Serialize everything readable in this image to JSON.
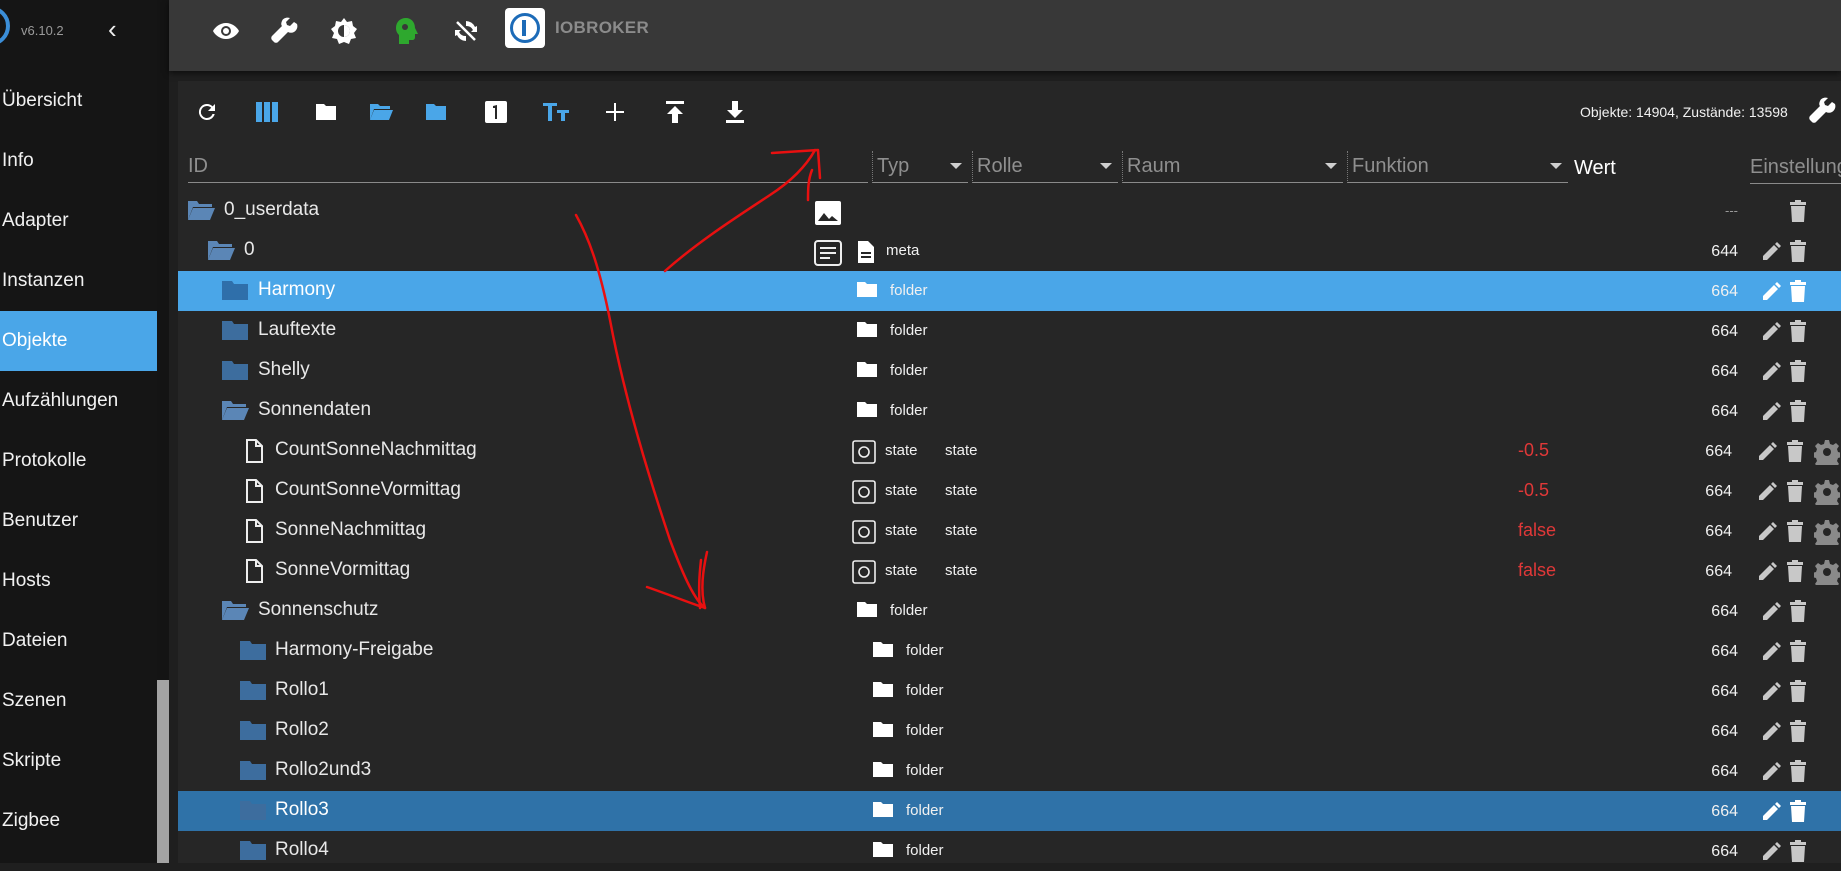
{
  "sidebar": {
    "version": "v6.10.2",
    "collapse_icon": "chevron-left",
    "items": [
      {
        "label": "Übersicht"
      },
      {
        "label": "Info"
      },
      {
        "label": "Adapter"
      },
      {
        "label": "Instanzen"
      },
      {
        "label": "Objekte",
        "active": true
      },
      {
        "label": "Aufzählungen"
      },
      {
        "label": "Protokolle"
      },
      {
        "label": "Benutzer"
      },
      {
        "label": "Hosts"
      },
      {
        "label": "Dateien"
      },
      {
        "label": "Szenen"
      },
      {
        "label": "Skripte"
      },
      {
        "label": "Zigbee"
      }
    ]
  },
  "topbar": {
    "icons": [
      "eye-icon",
      "wrench-icon",
      "theme-icon",
      "expert-mode-icon",
      "sync-icon"
    ],
    "brand": "IOBROKER"
  },
  "toolbar": {
    "icons": [
      "refresh-icon",
      "columns-icon",
      "folder-icon",
      "folder-open-icon",
      "folder-icon",
      "number-icon",
      "text-size-icon",
      "add-icon",
      "upload-icon",
      "download-icon"
    ],
    "stats": "Objekte: 14904, Zustände: 13598"
  },
  "columns": {
    "id": "ID",
    "typ": "Typ",
    "rolle": "Rolle",
    "raum": "Raum",
    "funktion": "Funktion",
    "wert": "Wert",
    "einstellungen": "Einstellungen"
  },
  "rows": [
    {
      "name": "0_userdata",
      "acl": "---",
      "typ": "",
      "role": "",
      "value": ""
    },
    {
      "name": "0",
      "typ": "meta",
      "role": "",
      "value": "",
      "acl": "644"
    },
    {
      "name": "Harmony",
      "typ": "folder",
      "role": "",
      "value": "",
      "acl": "664"
    },
    {
      "name": "Lauftexte",
      "typ": "folder",
      "role": "",
      "value": "",
      "acl": "664"
    },
    {
      "name": "Shelly",
      "typ": "folder",
      "role": "",
      "value": "",
      "acl": "664"
    },
    {
      "name": "Sonnendaten",
      "typ": "folder",
      "role": "",
      "value": "",
      "acl": "664"
    },
    {
      "name": "CountSonneNachmittag",
      "typ": "state",
      "role": "state",
      "value": "-0.5",
      "acl": "664"
    },
    {
      "name": "CountSonneVormittag",
      "typ": "state",
      "role": "state",
      "value": "-0.5",
      "acl": "664"
    },
    {
      "name": "SonneNachmittag",
      "typ": "state",
      "role": "state",
      "value": "false",
      "acl": "664"
    },
    {
      "name": "SonneVormittag",
      "typ": "state",
      "role": "state",
      "value": "false",
      "acl": "664"
    },
    {
      "name": "Sonnenschutz",
      "typ": "folder",
      "role": "",
      "value": "",
      "acl": "664"
    },
    {
      "name": "Harmony-Freigabe",
      "typ": "folder",
      "role": "",
      "value": "",
      "acl": "664"
    },
    {
      "name": "Rollo1",
      "typ": "folder",
      "role": "",
      "value": "",
      "acl": "664"
    },
    {
      "name": "Rollo2",
      "typ": "folder",
      "role": "",
      "value": "",
      "acl": "664"
    },
    {
      "name": "Rollo2und3",
      "typ": "folder",
      "role": "",
      "value": "",
      "acl": "664"
    },
    {
      "name": "Rollo3",
      "typ": "folder",
      "role": "",
      "value": "",
      "acl": "664"
    },
    {
      "name": "Rollo4",
      "typ": "folder",
      "role": "",
      "value": "",
      "acl": "664"
    }
  ],
  "colors": {
    "accent": "#4aa6e8",
    "selected_dark": "#2f72a8",
    "value_red": "#e03838",
    "annotation_red": "#e81010"
  }
}
